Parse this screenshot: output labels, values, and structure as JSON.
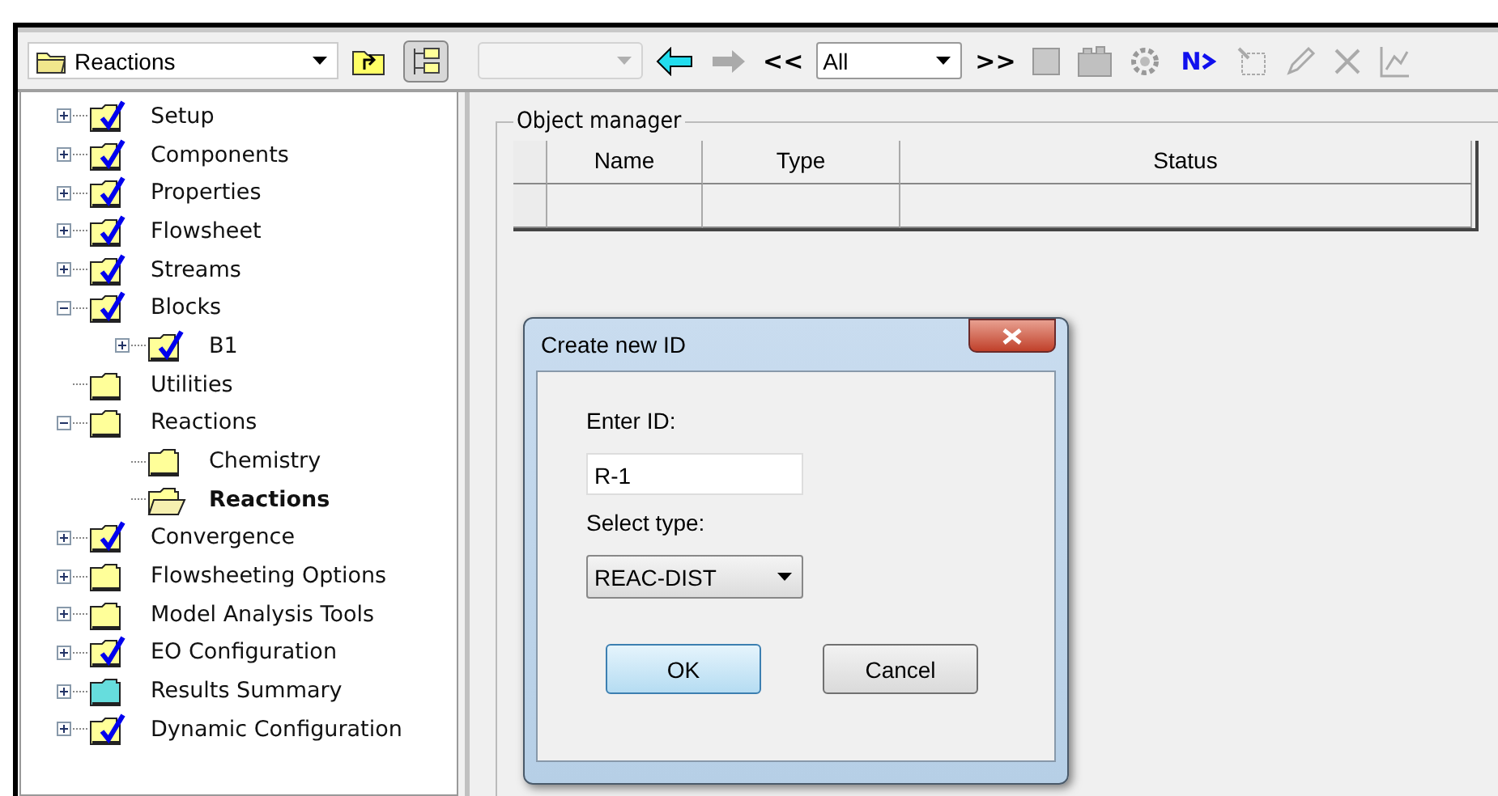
{
  "toolbar": {
    "location": "Reactions",
    "id_combo_disabled": true,
    "back_label": "<<",
    "filter": "All",
    "forward_label": ">>",
    "next_label": "N"
  },
  "tree": [
    {
      "label": "Setup",
      "expandable": true,
      "expanded": false,
      "checked": true,
      "color": "#ffff99",
      "selected": false
    },
    {
      "label": "Components",
      "expandable": true,
      "expanded": false,
      "checked": true,
      "color": "#ffff99",
      "selected": false
    },
    {
      "label": "Properties",
      "expandable": true,
      "expanded": false,
      "checked": true,
      "color": "#ffff99",
      "selected": false
    },
    {
      "label": "Flowsheet",
      "expandable": true,
      "expanded": false,
      "checked": true,
      "color": "#ffff99",
      "selected": false
    },
    {
      "label": "Streams",
      "expandable": true,
      "expanded": false,
      "checked": true,
      "color": "#ffff99",
      "selected": false
    },
    {
      "label": "Blocks",
      "expandable": true,
      "expanded": true,
      "checked": true,
      "color": "#ffff99",
      "selected": false,
      "children": [
        {
          "label": "B1",
          "expandable": true,
          "expanded": false,
          "checked": true,
          "color": "#ffff99",
          "selected": false
        }
      ]
    },
    {
      "label": "Utilities",
      "expandable": false,
      "expanded": false,
      "checked": false,
      "color": "#ffff99",
      "selected": false
    },
    {
      "label": "Reactions",
      "expandable": true,
      "expanded": true,
      "checked": false,
      "color": "#ffff99",
      "selected": false,
      "children": [
        {
          "label": "Chemistry",
          "expandable": false,
          "expanded": false,
          "checked": false,
          "color": "#ffff99",
          "selected": false
        },
        {
          "label": "Reactions",
          "expandable": false,
          "expanded": false,
          "checked": false,
          "color": "#ffff99",
          "selected": true
        }
      ]
    },
    {
      "label": "Convergence",
      "expandable": true,
      "expanded": false,
      "checked": true,
      "color": "#ffff99",
      "selected": false
    },
    {
      "label": "Flowsheeting Options",
      "expandable": true,
      "expanded": false,
      "checked": false,
      "color": "#ffff99",
      "selected": false
    },
    {
      "label": "Model Analysis Tools",
      "expandable": true,
      "expanded": false,
      "checked": false,
      "color": "#ffff99",
      "selected": false
    },
    {
      "label": "EO Configuration",
      "expandable": true,
      "expanded": false,
      "checked": true,
      "color": "#ffff99",
      "selected": false
    },
    {
      "label": "Results Summary",
      "expandable": true,
      "expanded": false,
      "checked": false,
      "color": "#66dddd",
      "selected": false
    },
    {
      "label": "Dynamic Configuration",
      "expandable": true,
      "expanded": false,
      "checked": true,
      "color": "#ffff99",
      "selected": false
    }
  ],
  "object_manager": {
    "title": "Object manager",
    "columns": [
      "Name",
      "Type",
      "Status"
    ]
  },
  "dialog": {
    "title": "Create new ID",
    "id_label": "Enter ID:",
    "id_value": "R-1",
    "type_label": "Select type:",
    "type_value": "REAC-DIST",
    "buttons": [
      {
        "label": "OK",
        "default": true
      },
      {
        "label": "Cancel",
        "default": false
      }
    ]
  }
}
